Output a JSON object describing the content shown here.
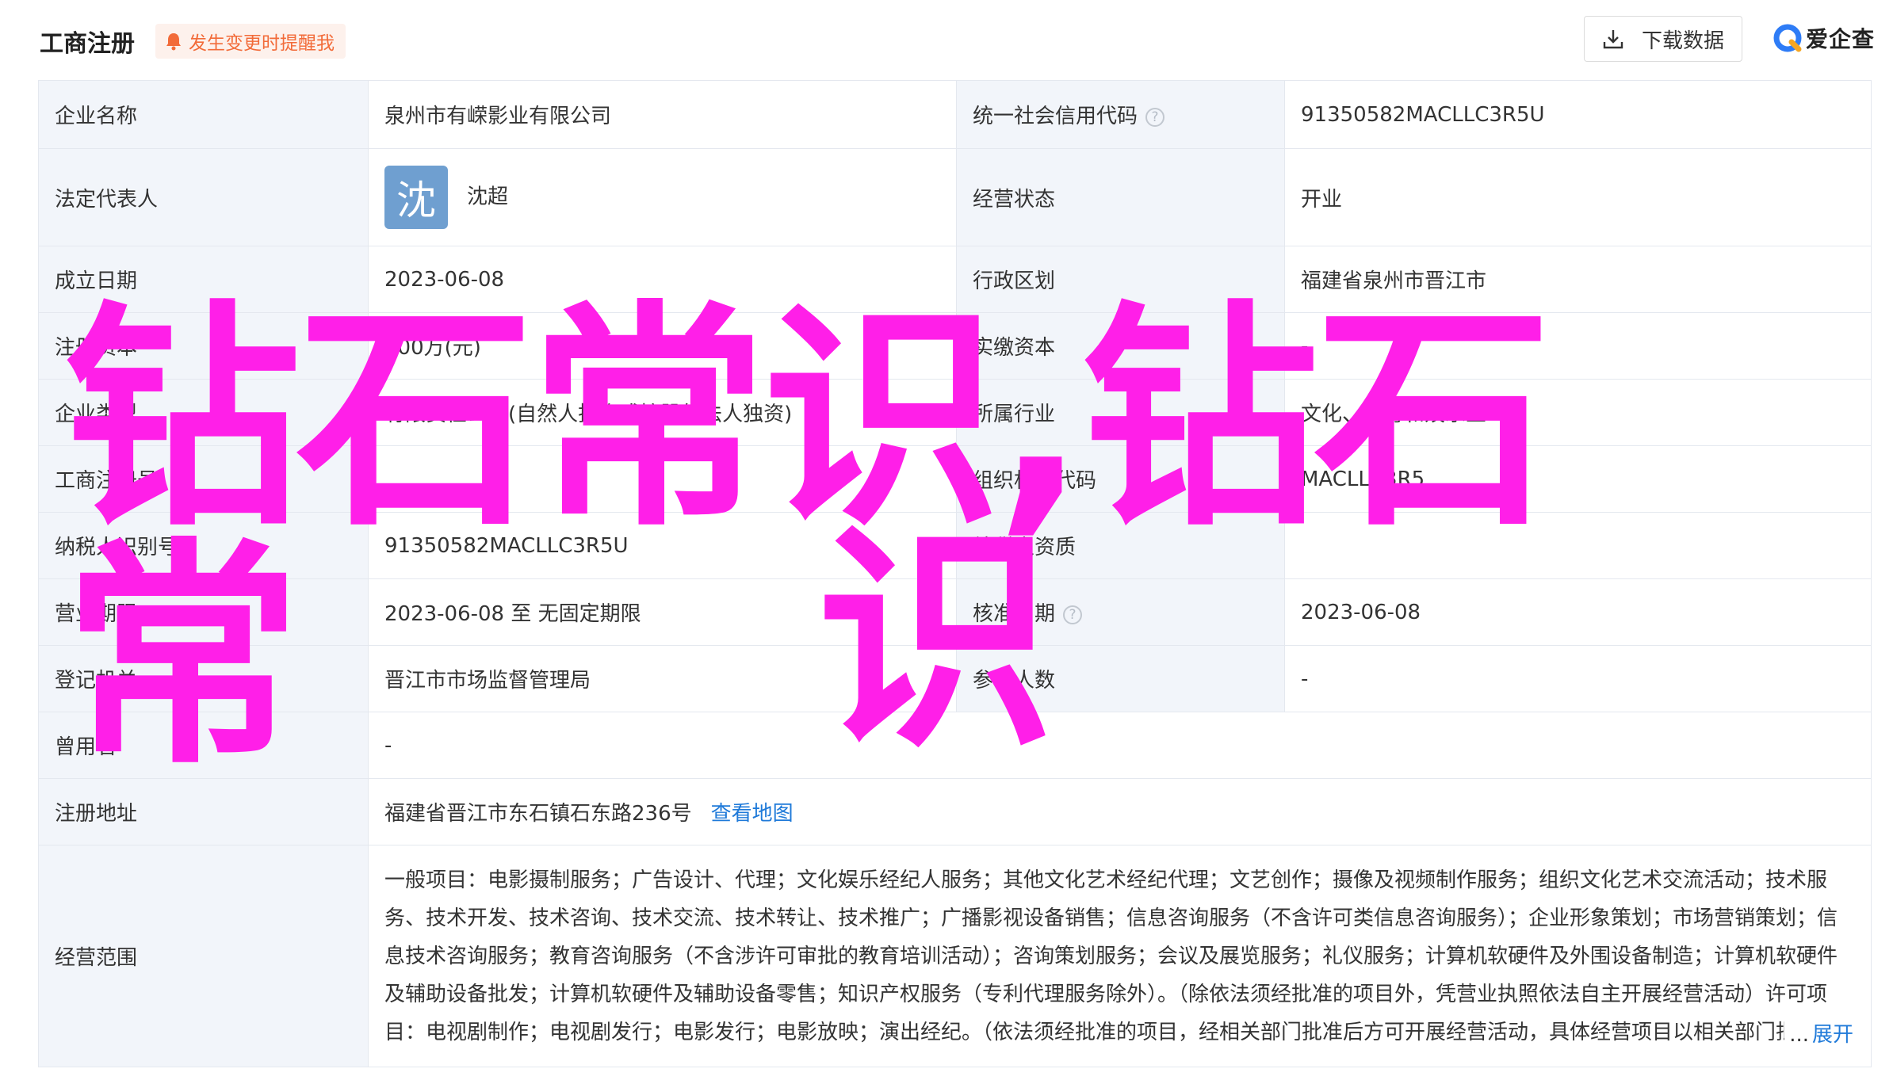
{
  "header": {
    "title": "工商注册",
    "alert": "发生变更时提醒我",
    "download": "下载数据",
    "logo": "爱企查"
  },
  "rows": {
    "r1": {
      "l1": "企业名称",
      "v1": "泉州市有嵘影业有限公司",
      "l2": "统一社会信用代码",
      "v2": "91350582MACLLC3R5U"
    },
    "r2": {
      "l1": "法定代表人",
      "avatar": "沈",
      "v1": "沈超",
      "l2": "经营状态",
      "v2": "开业"
    },
    "r3": {
      "l1": "成立日期",
      "v1": "2023-06-08",
      "l2": "行政区划",
      "v2": "福建省泉州市晋江市"
    },
    "r4": {
      "l1": "注册资本",
      "v1": "100万(元)",
      "l2": "实缴资本",
      "v2": "-"
    },
    "r5": {
      "l1": "企业类型",
      "v1": "有限责任公司(自然人投资或控股的法人独资)",
      "l2": "所属行业",
      "v2": "文化、体育和娱乐业"
    },
    "r6": {
      "l1": "工商注册号",
      "v1": "",
      "l2": "组织机构代码",
      "v2": "MACLLC3R5"
    },
    "r7": {
      "l1": "纳税人识别号",
      "v1": "91350582MACLLC3R5U",
      "l2": "纳税人资质",
      "v2": ""
    },
    "r8": {
      "l1": "营业期限",
      "v1": "2023-06-08 至 无固定期限",
      "l2": "核准日期",
      "v2": "2023-06-08"
    },
    "r9": {
      "l1": "登记机关",
      "v1": "晋江市市场监督管理局",
      "l2": "参保人数",
      "v2": "-"
    },
    "r10": {
      "l1": "曾用名",
      "v1": "-"
    },
    "r11": {
      "l1": "注册地址",
      "v1": "福建省晋江市东石镇石东路236号",
      "link": "查看地图"
    },
    "r12": {
      "l1": "经营范围",
      "v1": "一般项目：电影摄制服务；广告设计、代理；文化娱乐经纪人服务；其他文化艺术经纪代理；文艺创作；摄像及视频制作服务；组织文化艺术交流活动；技术服务、技术开发、技术咨询、技术交流、技术转让、技术推广；广播影视设备销售；信息咨询服务（不含许可类信息咨询服务）；企业形象策划；市场营销策划；信息技术咨询服务；教育咨询服务（不含涉许可审批的教育培训活动）；咨询策划服务；会议及展览服务；礼仪服务；计算机软硬件及外围设备制造；计算机软硬件及辅助设备批发；计算机软硬件及辅助设备零售；知识产权服务（专利代理服务除外）。（除依法须经批准的项目外，凭营业执照依法自主开展经营活动）许可项目：电视剧制作；电视剧发行；电影发行；电影放映；演出经纪。（依法须经批准的项目，经相关部门批准后方可开展经营活动，具体经营项目以相关部门批准文件或许可证件为准）",
      "ellipsis": "...",
      "more": "展开"
    }
  },
  "watermark": {
    "line1": "钻石常识,钻石常",
    "line2": "识"
  },
  "colors": {
    "watermark": "#ff1fe8",
    "link": "#1f7ad9",
    "alert": "#f26b39",
    "label_bg": "#f2f5fa"
  }
}
